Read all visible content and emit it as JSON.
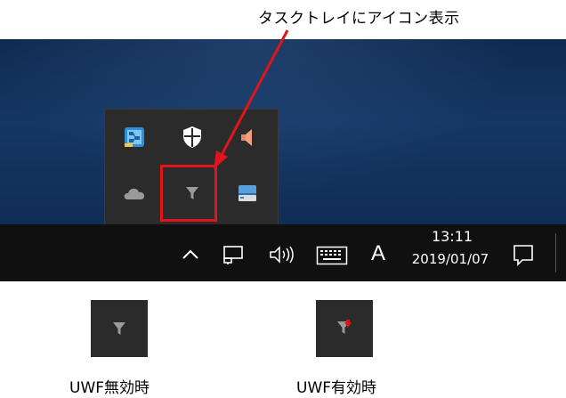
{
  "caption": "タスクトレイにアイコン表示",
  "tray_popup": {
    "icons": [
      {
        "name": "network-map-icon"
      },
      {
        "name": "windows-defender-shield-icon"
      },
      {
        "name": "speaker-icon"
      },
      {
        "name": "onedrive-cloud-icon"
      },
      {
        "name": "uwf-filter-icon"
      },
      {
        "name": "removable-drive-icon"
      }
    ]
  },
  "taskbar": {
    "clock_time": "13:11",
    "clock_date": "2019/01/07",
    "ime_mode": "A"
  },
  "legend": {
    "disabled_label": "UWF無効時",
    "enabled_label": "UWF有効時"
  },
  "colors": {
    "highlight": "#e0151b",
    "taskbar": "#101010",
    "tray_bg": "#2b2b2b",
    "desktop": "#143764"
  }
}
